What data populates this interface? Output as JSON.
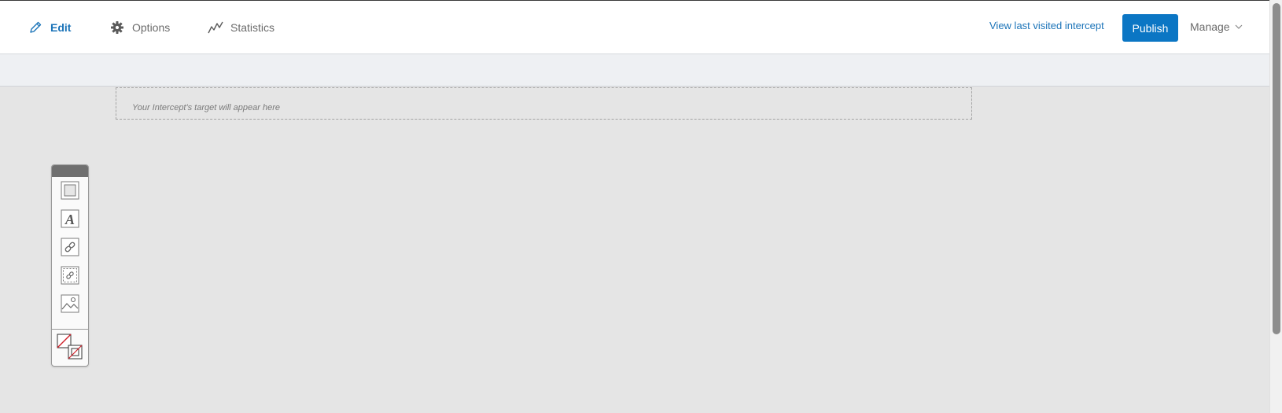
{
  "nav": {
    "tabs": [
      {
        "label": "Edit",
        "icon": "pencil-icon",
        "active": true
      },
      {
        "label": "Options",
        "icon": "gear-icon",
        "active": false
      },
      {
        "label": "Statistics",
        "icon": "line-chart-icon",
        "active": false
      }
    ]
  },
  "header": {
    "view_last_label": "View last visited intercept",
    "publish_label": "Publish",
    "manage_label": "Manage"
  },
  "canvas": {
    "target_placeholder": "Your Intercept's target will appear here"
  },
  "toolbox": {
    "tools": [
      {
        "icon": "box-icon"
      },
      {
        "icon": "text-icon"
      },
      {
        "icon": "link-icon"
      },
      {
        "icon": "hotspot-link-icon"
      },
      {
        "icon": "image-icon"
      },
      {
        "icon": "fill-stroke-color-icon"
      }
    ]
  },
  "colors": {
    "accent": "#1a73b8",
    "publish_button": "#0b76c4",
    "canvas_bg": "#e5e5e5"
  }
}
